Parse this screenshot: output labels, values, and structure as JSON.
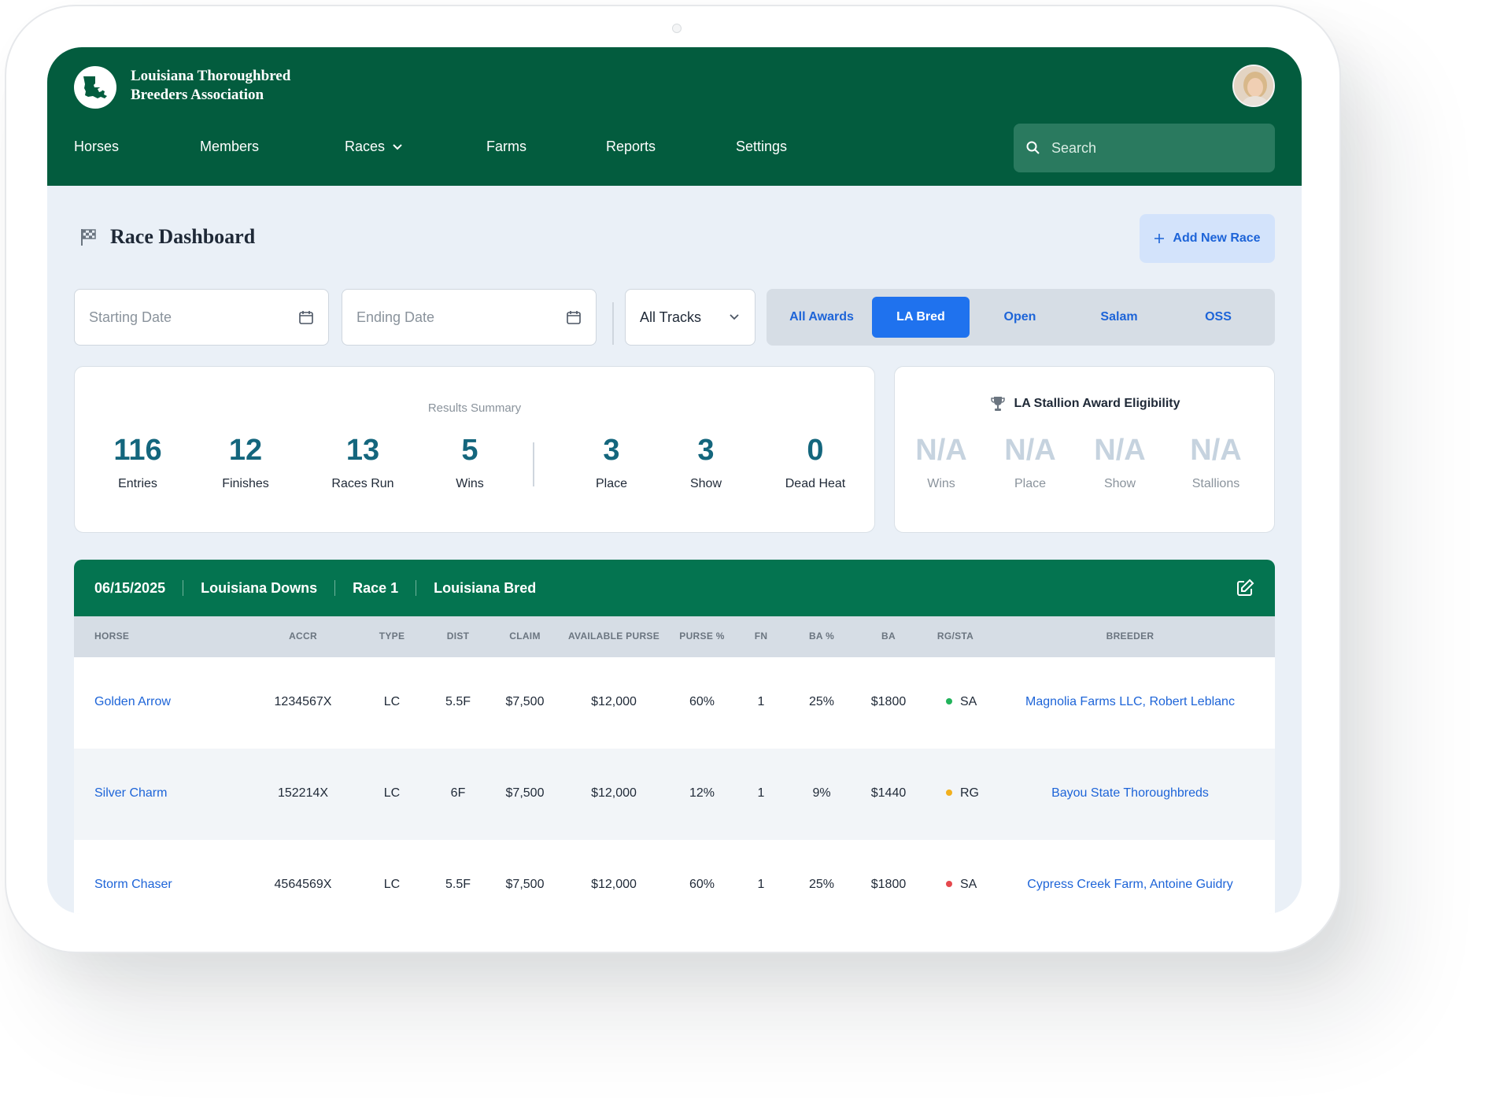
{
  "brand": {
    "line1": "Louisiana Thoroughbred",
    "line2": "Breeders Association"
  },
  "nav": [
    {
      "label": "Horses"
    },
    {
      "label": "Members"
    },
    {
      "label": "Races"
    },
    {
      "label": "Farms"
    },
    {
      "label": "Reports"
    },
    {
      "label": "Settings"
    }
  ],
  "search": {
    "placeholder": "Search"
  },
  "page": {
    "title": "Race Dashboard",
    "add_button": "Add New Race"
  },
  "filters": {
    "start_date_placeholder": "Starting Date",
    "end_date_placeholder": "Ending Date",
    "track_select": "All Tracks",
    "awards": [
      "All Awards",
      "LA Bred",
      "Open",
      "Salam",
      "OSS"
    ],
    "active_award": "LA Bred"
  },
  "results_summary": {
    "title": "Results Summary",
    "stats": [
      {
        "value": "116",
        "label": "Entries"
      },
      {
        "value": "12",
        "label": "Finishes"
      },
      {
        "value": "13",
        "label": "Races Run"
      },
      {
        "value": "5",
        "label": "Wins"
      },
      {
        "value": "3",
        "label": "Place"
      },
      {
        "value": "3",
        "label": "Show"
      },
      {
        "value": "0",
        "label": "Dead Heat"
      }
    ]
  },
  "stallion_award": {
    "title": "LA Stallion Award Eligibility",
    "stats": [
      {
        "value": "N/A",
        "label": "Wins"
      },
      {
        "value": "N/A",
        "label": "Place"
      },
      {
        "value": "N/A",
        "label": "Show"
      },
      {
        "value": "N/A",
        "label": "Stallions"
      }
    ]
  },
  "race": {
    "date": "06/15/2025",
    "track": "Louisiana Downs",
    "race": "Race 1",
    "category": "Louisiana Bred",
    "columns": [
      "HORSE",
      "ACCR",
      "TYPE",
      "DIST",
      "CLAIM",
      "AVAILABLE PURSE",
      "PURSE %",
      "FN",
      "BA %",
      "BA",
      "RG/STA",
      "BREEDER"
    ],
    "rows": [
      {
        "horse": "Golden Arrow",
        "accr": "1234567X",
        "type": "LC",
        "dist": "5.5F",
        "claim": "$7,500",
        "purse": "$12,000",
        "purse_pct": "60%",
        "fn": "1",
        "ba_pct": "25%",
        "ba": "$1800",
        "rgsta": "SA",
        "status_color": "#22b35b",
        "breeder": "Magnolia Farms LLC, Robert Leblanc"
      },
      {
        "horse": "Silver Charm",
        "accr": "152214X",
        "type": "LC",
        "dist": "6F",
        "claim": "$7,500",
        "purse": "$12,000",
        "purse_pct": "12%",
        "fn": "1",
        "ba_pct": "9%",
        "ba": "$1440",
        "rgsta": "RG",
        "status_color": "#f2b01e",
        "breeder": "Bayou State Thoroughbreds"
      },
      {
        "horse": "Storm Chaser",
        "accr": "4564569X",
        "type": "LC",
        "dist": "5.5F",
        "claim": "$7,500",
        "purse": "$12,000",
        "purse_pct": "60%",
        "fn": "1",
        "ba_pct": "25%",
        "ba": "$1800",
        "rgsta": "SA",
        "status_color": "#e5484d",
        "breeder": "Cypress Creek Farm, Antoine Guidry"
      }
    ]
  },
  "colors": {
    "header": "#035c3e",
    "race_bar": "#047450",
    "accent": "#1f72ee",
    "stat": "#14667d"
  }
}
